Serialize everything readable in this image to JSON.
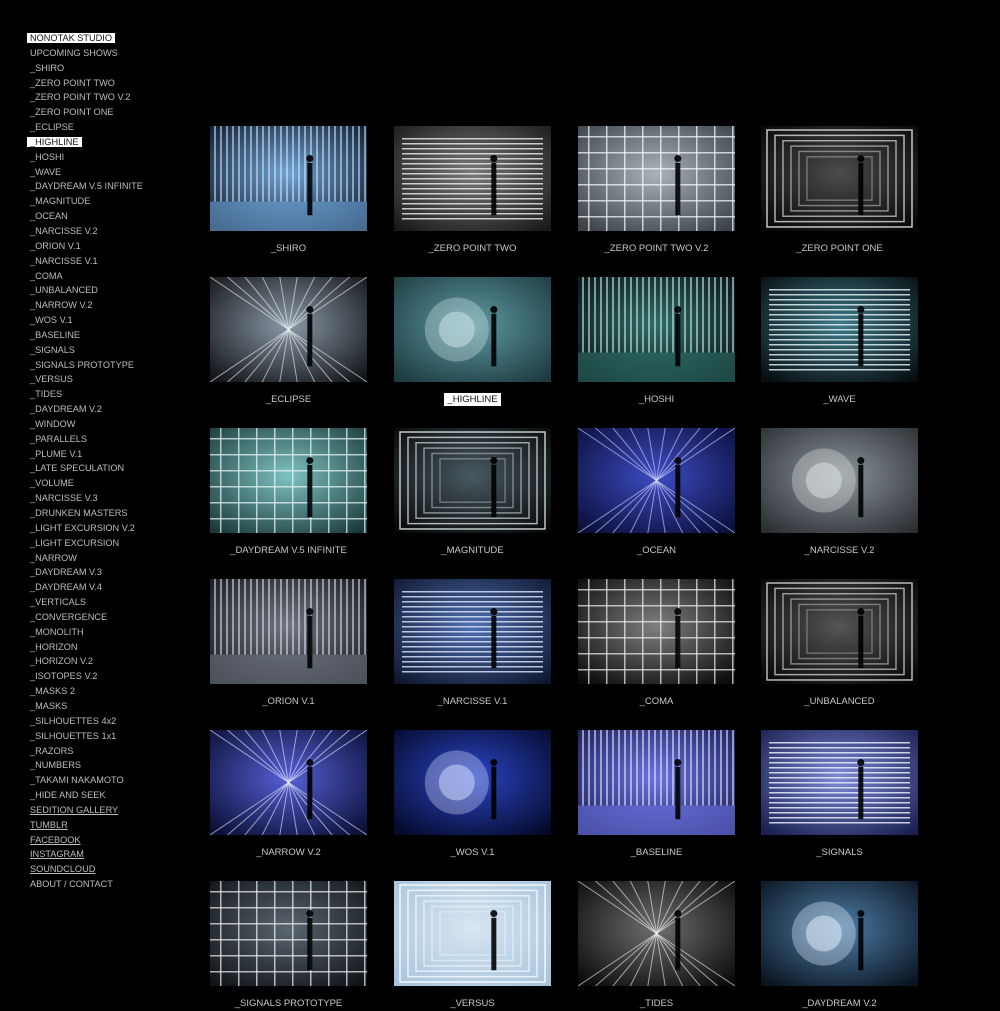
{
  "sidebar": {
    "items": [
      {
        "label": "NONOTAK STUDIO",
        "hl": true
      },
      {
        "label": "UPCOMING SHOWS"
      },
      {
        "label": "_SHIRO"
      },
      {
        "label": "_ZERO POINT TWO"
      },
      {
        "label": "_ZERO POINT TWO V.2"
      },
      {
        "label": "_ZERO POINT ONE"
      },
      {
        "label": "_ECLIPSE"
      },
      {
        "label": "_HIGHLINE",
        "hl": true
      },
      {
        "label": "_HOSHI"
      },
      {
        "label": "_WAVE"
      },
      {
        "label": "_DAYDREAM V.5 INFINITE"
      },
      {
        "label": "_MAGNITUDE"
      },
      {
        "label": "_OCEAN"
      },
      {
        "label": "_NARCISSE V.2"
      },
      {
        "label": "_ORION V.1"
      },
      {
        "label": "_NARCISSE V.1"
      },
      {
        "label": "_COMA"
      },
      {
        "label": "_UNBALANCED"
      },
      {
        "label": "_NARROW V.2"
      },
      {
        "label": "_WOS V.1"
      },
      {
        "label": "_BASELINE"
      },
      {
        "label": "_SIGNALS"
      },
      {
        "label": "_SIGNALS PROTOTYPE"
      },
      {
        "label": "_VERSUS"
      },
      {
        "label": "_TIDES"
      },
      {
        "label": "_DAYDREAM V.2"
      },
      {
        "label": "_WINDOW"
      },
      {
        "label": "_PARALLELS"
      },
      {
        "label": "_PLUME V.1"
      },
      {
        "label": "_LATE SPECULATION"
      },
      {
        "label": "_VOLUME"
      },
      {
        "label": "_NARCISSE V.3"
      },
      {
        "label": "_DRUNKEN MASTERS"
      },
      {
        "label": "_LIGHT EXCURSION V.2"
      },
      {
        "label": "_LIGHT EXCURSION"
      },
      {
        "label": "_NARROW"
      },
      {
        "label": "_DAYDREAM V.3"
      },
      {
        "label": "_DAYDREAM V.4"
      },
      {
        "label": "_VERTICALS"
      },
      {
        "label": "_CONVERGENCE"
      },
      {
        "label": "_MONOLITH"
      },
      {
        "label": "_HORIZON"
      },
      {
        "label": "_HORIZON V.2"
      },
      {
        "label": "_ISOTOPES V.2"
      },
      {
        "label": "_MASKS 2"
      },
      {
        "label": "_MASKS"
      },
      {
        "label": "_SILHOUETTES 4x2"
      },
      {
        "label": "_SILHOUETTES 1x1"
      },
      {
        "label": "_RAZORS"
      },
      {
        "label": "_NUMBERS"
      },
      {
        "label": "_TAKAMI NAKAMOTO"
      },
      {
        "label": "_HIDE AND SEEK"
      },
      {
        "label": "SEDITION GALLERY",
        "link": true
      },
      {
        "label": "TUMBLR",
        "link": true
      },
      {
        "label": "FACEBOOK",
        "link": true
      },
      {
        "label": "INSTAGRAM",
        "link": true
      },
      {
        "label": "SOUNDCLOUD",
        "link": true
      },
      {
        "label": "ABOUT / CONTACT"
      }
    ]
  },
  "projects": [
    {
      "title": "_SHIRO",
      "icon": "shiro-thumbnail",
      "colors": [
        "#0b1a2e",
        "#6fa3d6",
        "#dfe9f5"
      ]
    },
    {
      "title": "_ZERO POINT TWO",
      "icon": "zero-point-two-thumbnail",
      "colors": [
        "#1a1a1a",
        "#7a7a7a",
        "#f0f0f0"
      ]
    },
    {
      "title": "_ZERO POINT TWO V.2",
      "icon": "zero-point-two-v2-thumbnail",
      "colors": [
        "#3a4248",
        "#a9b3ba",
        "#ffffff"
      ]
    },
    {
      "title": "_ZERO POINT ONE",
      "icon": "zero-point-one-thumbnail",
      "colors": [
        "#050505",
        "#4c4c4c",
        "#e8e8e8"
      ]
    },
    {
      "title": "_ECLIPSE",
      "icon": "eclipse-thumbnail",
      "colors": [
        "#111418",
        "#8c9aa8",
        "#f2f4f6"
      ]
    },
    {
      "title": "_HIGHLINE",
      "icon": "highline-thumbnail",
      "colors": [
        "#1d3a40",
        "#5f9aa3",
        "#cfe6e8"
      ],
      "hl": true
    },
    {
      "title": "_HOSHI",
      "icon": "hoshi-thumbnail",
      "colors": [
        "#061214",
        "#2f6e68",
        "#dff6f3"
      ]
    },
    {
      "title": "_WAVE",
      "icon": "wave-thumbnail",
      "colors": [
        "#070d10",
        "#3e7a88",
        "#eaf7fa"
      ]
    },
    {
      "title": "_DAYDREAM V.5 INFINITE",
      "icon": "daydream-v5-infinite-thumbnail",
      "colors": [
        "#1a3a3a",
        "#7fc2c2",
        "#f0fbfb"
      ]
    },
    {
      "title": "_MAGNITUDE",
      "icon": "magnitude-thumbnail",
      "colors": [
        "#050708",
        "#4a5a62",
        "#dfe7ea"
      ]
    },
    {
      "title": "_OCEAN",
      "icon": "ocean-thumbnail",
      "colors": [
        "#0a0f3a",
        "#3d4cc4",
        "#d8dcff"
      ]
    },
    {
      "title": "_NARCISSE V.2",
      "icon": "narcisse-v2-thumbnail",
      "colors": [
        "#2a2f33",
        "#8d969b",
        "#dfe4e6"
      ]
    },
    {
      "title": "_ORION V.1",
      "icon": "orion-v1-thumbnail",
      "colors": [
        "#16191e",
        "#6f7682",
        "#e6e9ee"
      ]
    },
    {
      "title": "_NARCISSE V.1",
      "icon": "narcisse-v1-thumbnail",
      "colors": [
        "#0f1830",
        "#4f6fb0",
        "#e0e9ff"
      ]
    },
    {
      "title": "_COMA",
      "icon": "coma-thumbnail",
      "colors": [
        "#0a0a0a",
        "#808080",
        "#f2f2f2"
      ]
    },
    {
      "title": "_UNBALANCED",
      "icon": "unbalanced-thumbnail",
      "colors": [
        "#050505",
        "#555555",
        "#d8d8d8"
      ]
    },
    {
      "title": "_NARROW V.2",
      "icon": "narrow-v2-thumbnail",
      "colors": [
        "#0b0f35",
        "#5560d6",
        "#ecefff"
      ]
    },
    {
      "title": "_WOS V.1",
      "icon": "wos-v1-thumbnail",
      "colors": [
        "#040a2a",
        "#2a45c8",
        "#d6e0ff"
      ]
    },
    {
      "title": "_BASELINE",
      "icon": "baseline-thumbnail",
      "colors": [
        "#1c1f5a",
        "#6a73e0",
        "#f0f2ff"
      ]
    },
    {
      "title": "_SIGNALS",
      "icon": "signals-thumbnail",
      "colors": [
        "#1a2050",
        "#7d8ad8",
        "#f4f6ff"
      ]
    },
    {
      "title": "_SIGNALS PROTOTYPE",
      "icon": "signals-prototype-thumbnail",
      "colors": [
        "#101418",
        "#5a6670",
        "#f5f7f8"
      ]
    },
    {
      "title": "_VERSUS",
      "icon": "versus-thumbnail",
      "colors": [
        "#a8c4dc",
        "#d7e6f2",
        "#ffffff"
      ]
    },
    {
      "title": "_TIDES",
      "icon": "tides-thumbnail",
      "colors": [
        "#0a0a0a",
        "#6e6e6e",
        "#f5f5f5"
      ]
    },
    {
      "title": "_DAYDREAM V.2",
      "icon": "daydream-v2-thumbnail",
      "colors": [
        "#0a1420",
        "#4d7da8",
        "#e8f4ff"
      ]
    }
  ]
}
